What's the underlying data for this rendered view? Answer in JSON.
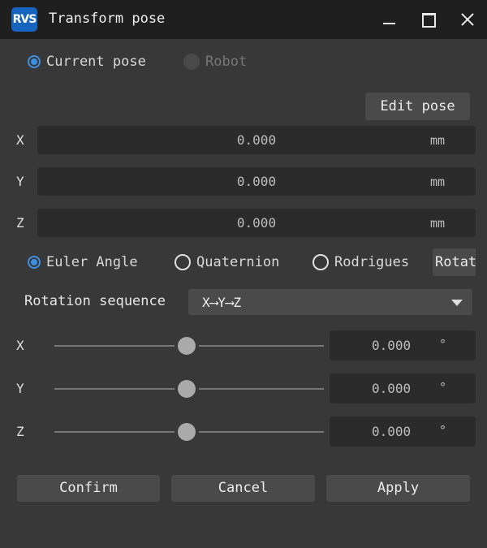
{
  "window": {
    "title": "Transform pose",
    "logo_text": "RVS",
    "controls": [
      "minimize",
      "maximize",
      "close"
    ]
  },
  "pose_source": {
    "options": [
      {
        "label": "Current pose",
        "checked": true,
        "enabled": true
      },
      {
        "label": "Robot",
        "checked": false,
        "enabled": false
      }
    ]
  },
  "edit_pose_label": "Edit pose",
  "translation": [
    {
      "axis": "X",
      "value": "0.000",
      "unit": "mm"
    },
    {
      "axis": "Y",
      "value": "0.000",
      "unit": "mm"
    },
    {
      "axis": "Z",
      "value": "0.000",
      "unit": "mm"
    }
  ],
  "rotation_mode": {
    "options": [
      {
        "label": "Euler Angle",
        "checked": true
      },
      {
        "label": "Quaternion",
        "checked": false
      },
      {
        "label": "Rodrigues",
        "checked": false
      }
    ],
    "extra_tab_label": "Rotat"
  },
  "rotation_sequence": {
    "label": "Rotation sequence",
    "selected": "X⟶Y⟶Z"
  },
  "rotation": [
    {
      "axis": "X",
      "value": "0.000",
      "unit": "°",
      "slider_fraction": 0.5
    },
    {
      "axis": "Y",
      "value": "0.000",
      "unit": "°",
      "slider_fraction": 0.5
    },
    {
      "axis": "Z",
      "value": "0.000",
      "unit": "°",
      "slider_fraction": 0.5
    }
  ],
  "actions": {
    "confirm": "Confirm",
    "cancel": "Cancel",
    "apply": "Apply"
  },
  "colors": {
    "accent": "#3d8fe0",
    "background": "#383838",
    "titlebar": "#1f1f1f",
    "logo": "#1565c0"
  }
}
